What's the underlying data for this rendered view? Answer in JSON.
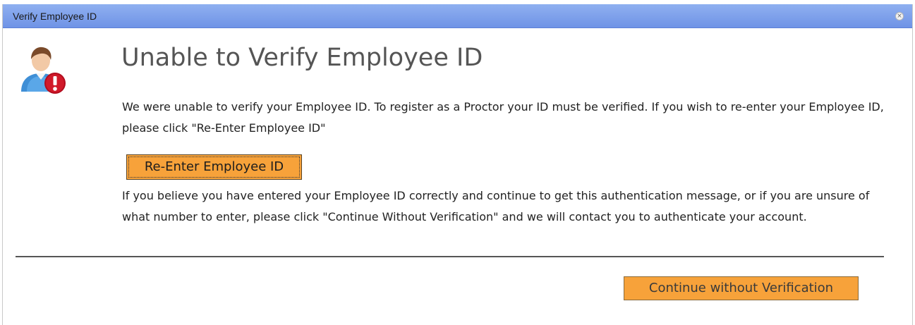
{
  "dialog": {
    "title": "Verify Employee ID",
    "close_glyph": "×",
    "heading": "Unable to Verify Employee ID",
    "message": "We were unable to verify your Employee ID. To register as a Proctor your ID must be verified. If you wish to re-enter your Employee ID, please click \"Re-Enter Employee ID\"",
    "reenter_button": "Re-Enter Employee ID",
    "help_message": "If you believe you have entered your Employee ID correctly and continue to get this authentication message, or if you are unsure of what number to enter, please click \"Continue Without Verification\" and we will contact you to authenticate your account.",
    "continue_button": "Continue without Verification"
  },
  "icons": {
    "close": "close-icon",
    "user_error": "user-error-icon"
  },
  "colors": {
    "titlebar": "#7b9ceb",
    "button": "#f7a23a",
    "heading": "#555555",
    "error_badge": "#c8102e"
  }
}
